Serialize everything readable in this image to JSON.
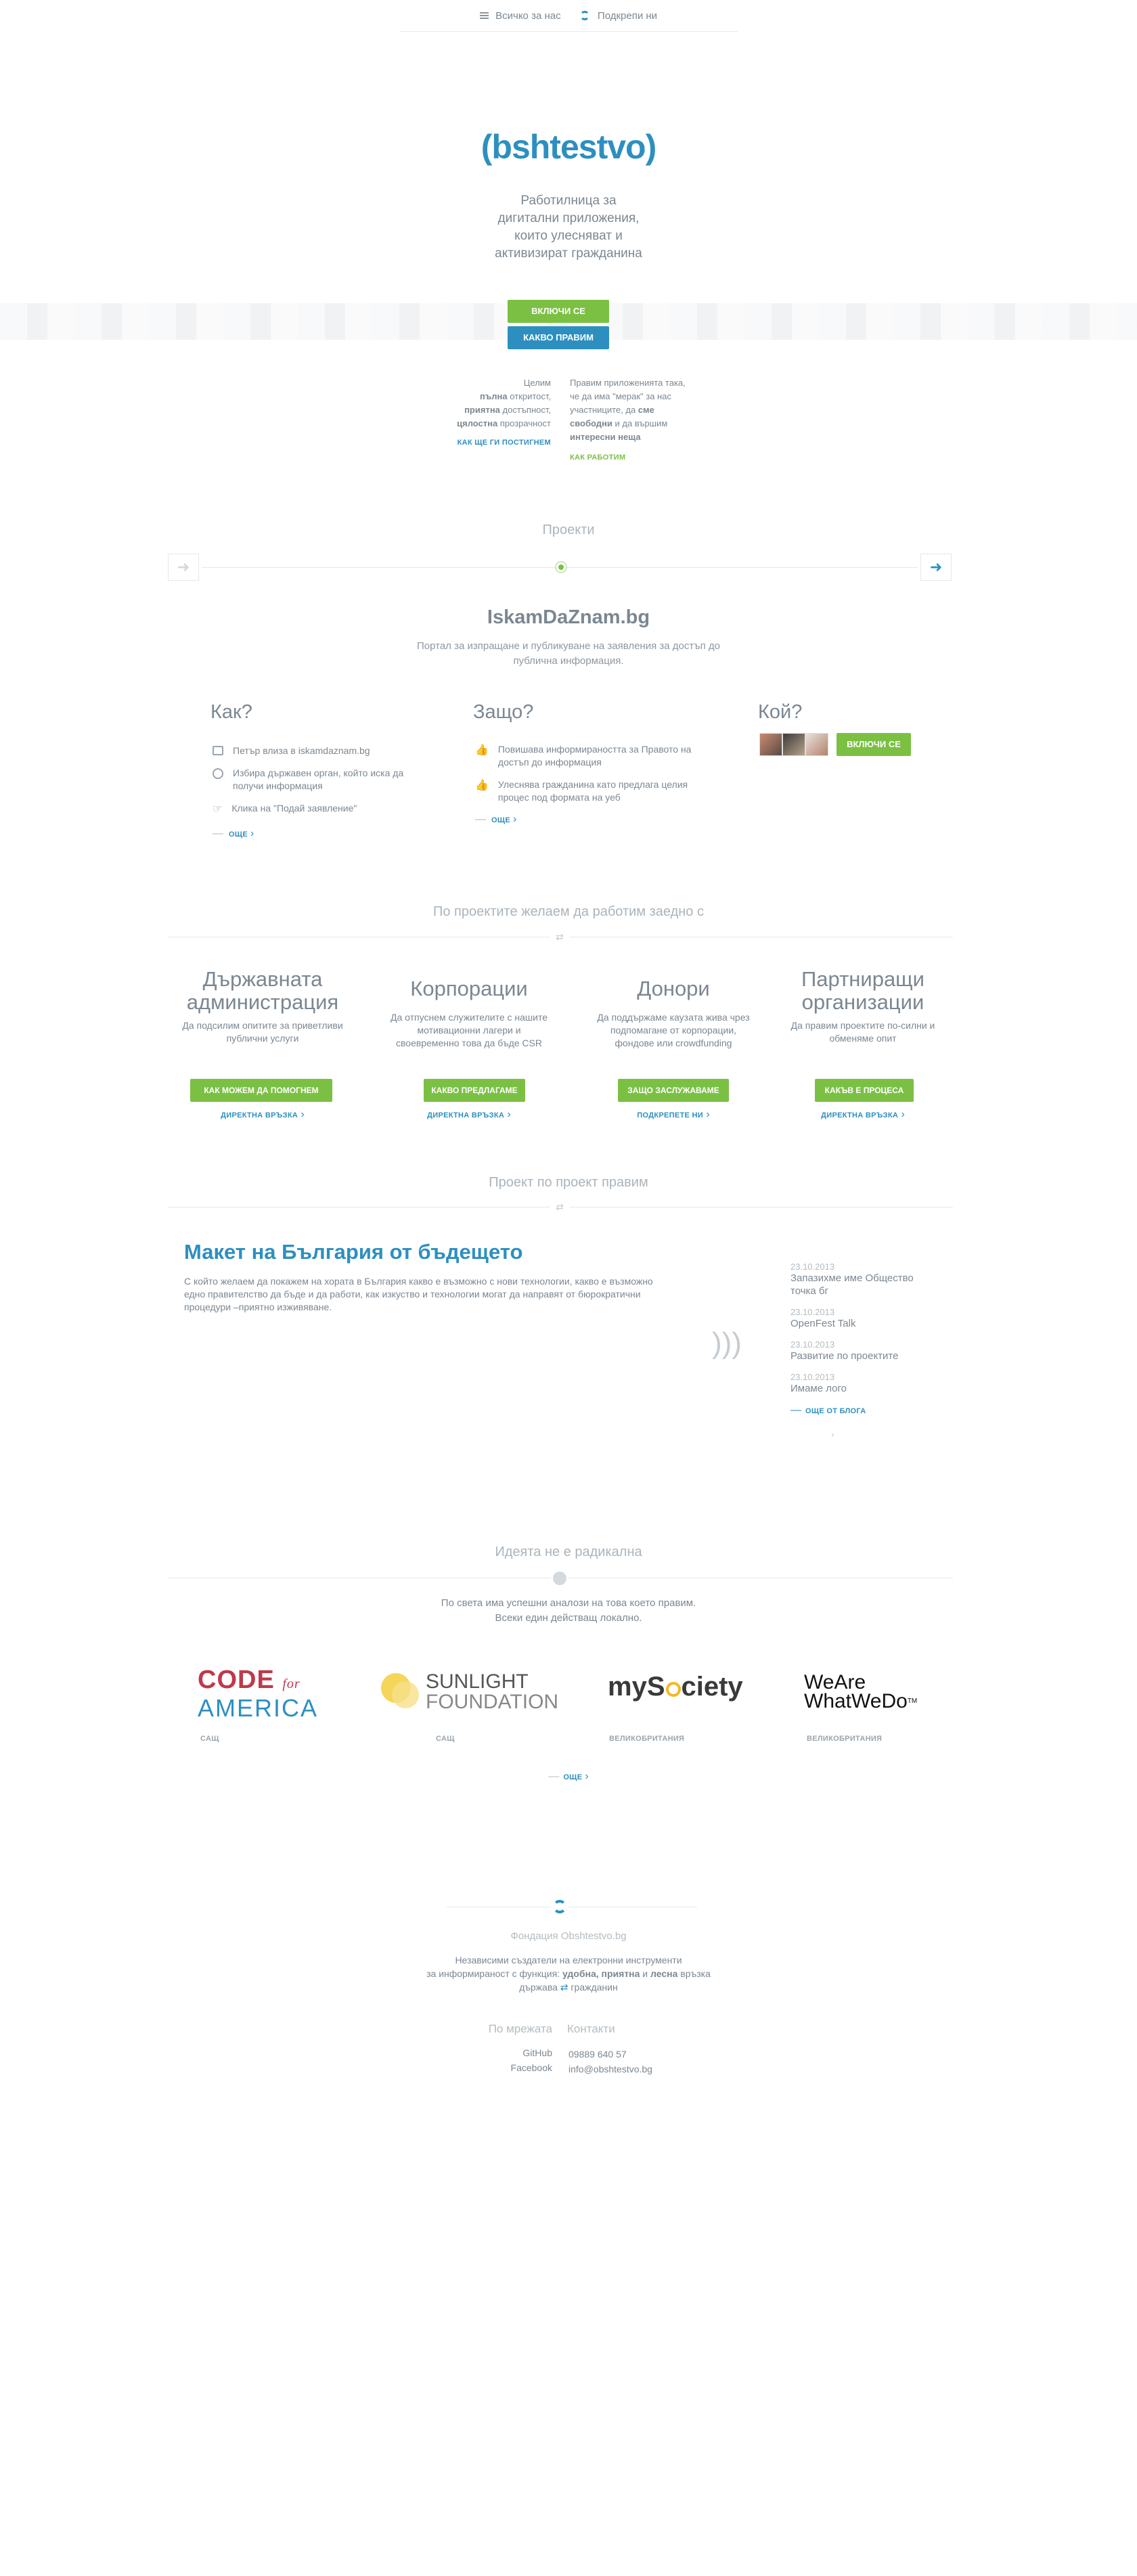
{
  "nav": {
    "about": "Всичко за нас",
    "support": "Подкрепи ни"
  },
  "logo": {
    "text_a": "bshtestv",
    "brand_open": "(",
    "brand_close": "o)"
  },
  "tagline": [
    "Работилница за",
    "дигитални приложения,",
    "които улесняват и",
    "активизират гражданина"
  ],
  "hero": {
    "join": "ВКЛЮЧИ СЕ",
    "what": "КАКВО ПРАВИМ"
  },
  "goals": {
    "left_1": "Целим",
    "left_2a": "пълна",
    "left_2b": " откритост,",
    "left_3a": "приятна",
    "left_3b": " достъпност,",
    "left_4a": "цялостна",
    "left_4b": " прозрачност",
    "left_link": "КАК ЩЕ ГИ ПОСТИГНЕМ",
    "right_1": "Правим приложенията така,",
    "right_2": "че да има \"мерак\" за нас",
    "right_3a": "участниците, да ",
    "right_3b": "сме",
    "right_4a": "свободни",
    "right_4b": " и да вършим",
    "right_5": "интересни неща",
    "right_link": "КАК РАБОТИМ"
  },
  "projects": {
    "title": "Проекти",
    "name": "IskamDaZnam.bg",
    "desc_1": "Портал за изпращане и публикуване на заявления за достъп до",
    "desc_2": "публична информация.",
    "how_title": "Как?",
    "how": [
      {
        "icon": "card-icon",
        "text": "Петър влиза в iskamdaznam.bg"
      },
      {
        "icon": "target-icon",
        "text": "Избира държавен орган, който иска да получи информация"
      },
      {
        "icon": "pointer-icon",
        "text": "Клика на \"Подай заявление\""
      }
    ],
    "how_more": "ОЩЕ",
    "why_title": "Защо?",
    "why": [
      {
        "icon": "thumb-icon",
        "text": "Повишава информираността за Правото на достъп до информация"
      },
      {
        "icon": "thumb-icon",
        "text": "Улеснява гражданина като предлага целия процес под формата на уеб"
      }
    ],
    "why_more": "ОЩЕ",
    "who_title": "Кой?",
    "who_join": "ВКЛЮЧИ СЕ"
  },
  "partners": {
    "title": "По проектите желаем да работим заедно с",
    "cols": [
      {
        "title_1": "Държавната",
        "title_2": "администрация",
        "desc_1": "Да подсилим опитите за приветливи",
        "desc_2": "публични услуги",
        "desc_3": "",
        "button": "КАК МОЖЕМ ДА ПОМОГНЕМ",
        "link": "ДИРЕКТНА ВРЪЗКА"
      },
      {
        "title_1": "Корпорации",
        "title_2": "",
        "desc_1": "Да отпуснем служителите с нашите",
        "desc_2": "мотивационни лагери и",
        "desc_3": "своевременно това да бъде CSR",
        "button": "КАКВО ПРЕДЛАГАМЕ",
        "link": "ДИРЕКТНА ВРЪЗКА"
      },
      {
        "title_1": "Донори",
        "title_2": "",
        "desc_1": "Да поддържаме каузата жива чрез",
        "desc_2": "подпомагане от корпорации,",
        "desc_3": "фондове или crowdfunding",
        "button": "ЗАЩО ЗАСЛУЖАВАМЕ",
        "link": "ПОДКРЕПЕТЕ НИ"
      },
      {
        "title_1": "Партниращи",
        "title_2": "организации",
        "desc_1": "Да правим проектите по-силни и",
        "desc_2": "обменяме опит",
        "desc_3": "",
        "button": "КАКЪВ Е ПРОЦЕСА",
        "link": "ДИРЕКТНА ВРЪЗКА"
      }
    ]
  },
  "blog": {
    "title": "Проект по проект правим",
    "post_title": "Макет на България от бъдещето",
    "post_1": "С който желаем да покажем на хората в България какво е възможно с нови технологии, какво е възможно",
    "post_2": "едно правителство да бъде и да работи, как изкуство и технологии могат да направят от бюрократични",
    "post_3": "процедури –приятно изживяване.",
    "news": [
      {
        "date": "23.10.2013",
        "title_1": "Запазихме име Общество",
        "title_2": "точка бг"
      },
      {
        "date": "23.10.2013",
        "title_1": "OpenFest Talk",
        "title_2": ""
      },
      {
        "date": "23.10.2013",
        "title_1": "Развитие по проектите",
        "title_2": ""
      },
      {
        "date": "23.10.2013",
        "title_1": "Имаме лого",
        "title_2": ""
      }
    ],
    "more": "ОЩЕ ОТ БЛОГА"
  },
  "idea": {
    "title": "Идеята не е радикална",
    "desc_1": "По света има успешни аналози на това което правим.",
    "desc_2": "Всеки един действащ локално.",
    "orgs": [
      {
        "logo_1": "CODE",
        "logo_2": "for",
        "logo_3": "AMERICA",
        "country": "САЩ"
      },
      {
        "logo_1": "SUNLIGHT",
        "logo_2": "FOUNDATION",
        "logo_3": "",
        "country": "САЩ"
      },
      {
        "logo_1": "myS",
        "logo_2": "ciety",
        "logo_3": "",
        "country": "ВЕЛИКОБРИТАНИЯ"
      },
      {
        "logo_1": "WeAre",
        "logo_2": "WhatWeDo",
        "logo_3": "TM",
        "country": "ВЕЛИКОБРИТАНИЯ"
      }
    ],
    "more": "ОЩЕ"
  },
  "footer": {
    "foundation": "Фондация Obshtestvo.bg",
    "desc_1": "Независими създатели на електронни инструменти",
    "desc_2a": "за информираност с функция: ",
    "desc_2b": "удобна, приятна",
    "desc_2c": " и ",
    "desc_2d": "лесна",
    "desc_2e": " връзка",
    "desc_3a": "държава",
    "desc_3b": "гражданин",
    "net_title": "По мрежата",
    "net_1": "GitHub",
    "net_2": "Facebook",
    "contact_title": "Контакти",
    "phone": "09889 640 57",
    "email": "info@obshtestvo.bg"
  },
  "colors": {
    "blue": "#2d8fc0",
    "green": "#7bc043",
    "text": "#7b8791"
  }
}
